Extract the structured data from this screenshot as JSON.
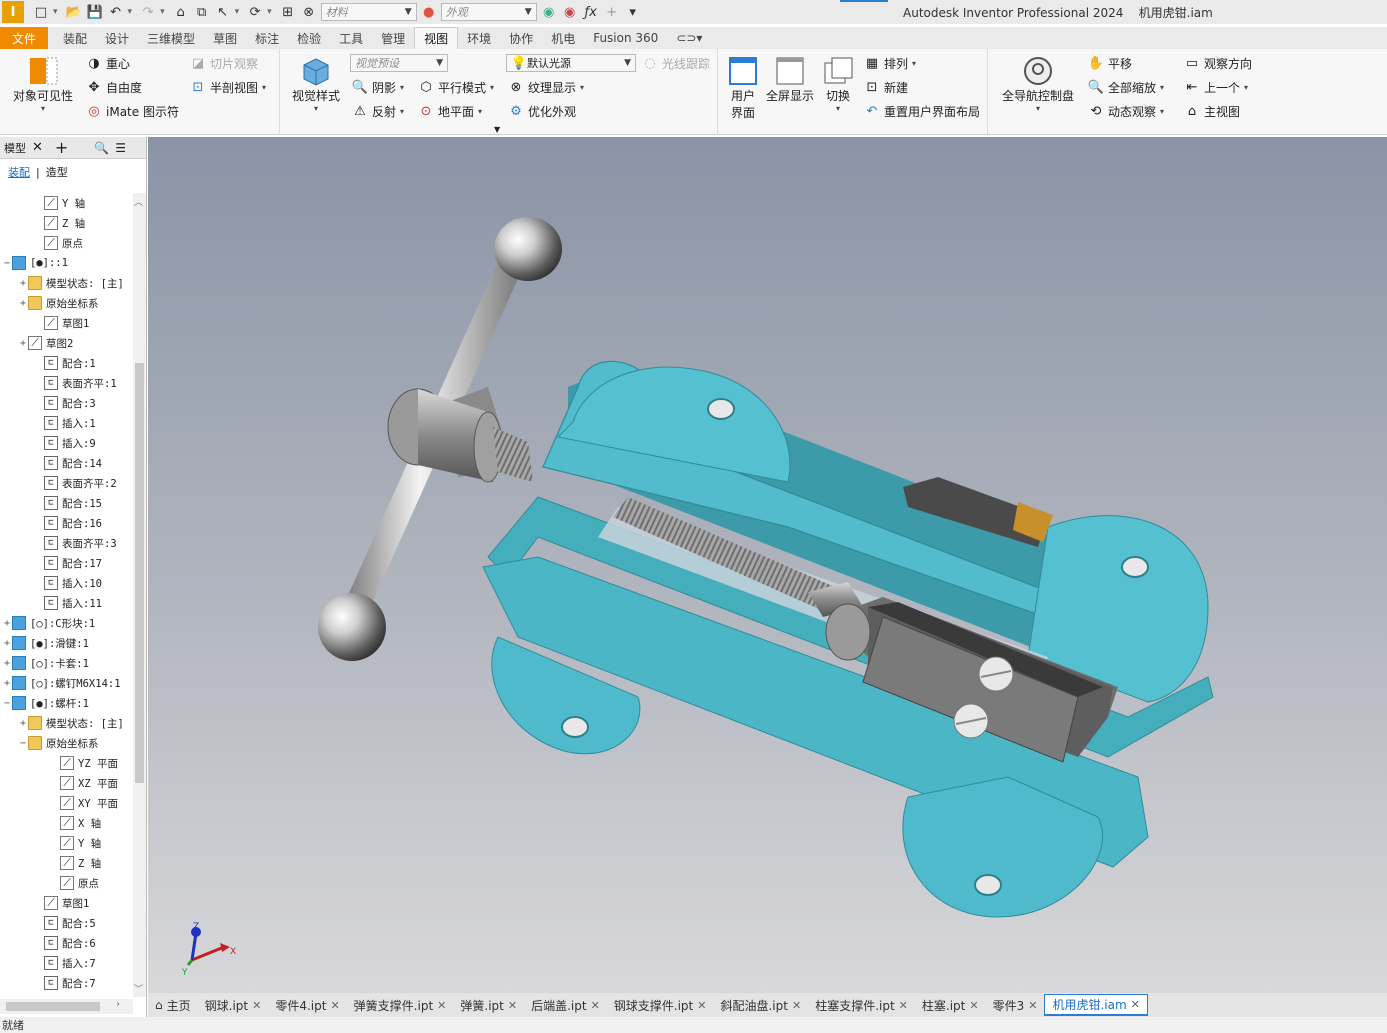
{
  "title": {
    "app": "Autodesk Inventor Professional 2024",
    "file": "机用虎钳.iam",
    "app_letter": "I",
    "material_placeholder": "材料",
    "appearance_placeholder": "外观"
  },
  "tabs": [
    "文件",
    "装配",
    "设计",
    "三维模型",
    "草图",
    "标注",
    "检验",
    "工具",
    "管理",
    "视图",
    "环境",
    "协作",
    "机电",
    "Fusion 360"
  ],
  "active_tab": "视图",
  "ribbon": {
    "visibility": {
      "big": "对象可见性",
      "center_gravity": "重心",
      "dof": "自由度",
      "imate": "iMate 图示符",
      "slice": "切片观察",
      "half_section": "半剖视图"
    },
    "appearance": {
      "visual_style": "视觉样式",
      "visual_preset": "视觉预设",
      "shadows": "阴影",
      "reflections": "反射",
      "ortho": "平行模式",
      "ground_plane": "地平面",
      "lighting": "默认光源",
      "texture": "纹理显示",
      "optimize": "优化外观",
      "raytrace": "光线跟踪"
    },
    "windows": {
      "user_interface": "用户界面",
      "fullscreen": "全屏显示",
      "switch": "切换",
      "arrange": "排列",
      "new": "新建",
      "reset": "重置用户界面布局"
    },
    "navigate": {
      "navbar": "全导航控制盘",
      "pan": "平移",
      "zoom_all": "全部缩放",
      "orbit": "动态观察",
      "look_at": "观察方向",
      "previous": "上一个",
      "home": "主视图"
    }
  },
  "browser": {
    "tab_label": "模型",
    "subtabs": [
      "装配",
      "造型"
    ],
    "active_subtab": "装配",
    "nodes": [
      {
        "indent": 2,
        "icon": "ref",
        "label": "Y 轴"
      },
      {
        "indent": 2,
        "icon": "ref",
        "label": "Z 轴"
      },
      {
        "indent": 2,
        "icon": "ref",
        "label": "原点"
      },
      {
        "indent": 0,
        "expander": "−",
        "icon": "part",
        "label": "[●]::1"
      },
      {
        "indent": 1,
        "expander": "+",
        "icon": "folder",
        "label": "模型状态: [主]"
      },
      {
        "indent": 1,
        "expander": "+",
        "icon": "folder",
        "label": "原始坐标系"
      },
      {
        "indent": 2,
        "icon": "ref",
        "label": "草图1"
      },
      {
        "indent": 1,
        "expander": "+",
        "icon": "ref",
        "label": "草图2"
      },
      {
        "indent": 2,
        "icon": "con",
        "label": "配合:1"
      },
      {
        "indent": 2,
        "icon": "con",
        "label": "表面齐平:1"
      },
      {
        "indent": 2,
        "icon": "con",
        "label": "配合:3"
      },
      {
        "indent": 2,
        "icon": "con",
        "label": "插入:1"
      },
      {
        "indent": 2,
        "icon": "con",
        "label": "插入:9"
      },
      {
        "indent": 2,
        "icon": "con",
        "label": "配合:14"
      },
      {
        "indent": 2,
        "icon": "con",
        "label": "表面齐平:2"
      },
      {
        "indent": 2,
        "icon": "con",
        "label": "配合:15"
      },
      {
        "indent": 2,
        "icon": "con",
        "label": "配合:16"
      },
      {
        "indent": 2,
        "icon": "con",
        "label": "表面齐平:3"
      },
      {
        "indent": 2,
        "icon": "con",
        "label": "配合:17"
      },
      {
        "indent": 2,
        "icon": "con",
        "label": "插入:10"
      },
      {
        "indent": 2,
        "icon": "con",
        "label": "插入:11"
      },
      {
        "indent": 0,
        "expander": "+",
        "icon": "part",
        "label": "[○]:C形块:1"
      },
      {
        "indent": 0,
        "expander": "+",
        "icon": "part",
        "label": "[●]:滑键:1"
      },
      {
        "indent": 0,
        "expander": "+",
        "icon": "part",
        "label": "[○]:卡套:1"
      },
      {
        "indent": 0,
        "expander": "+",
        "icon": "part",
        "label": "[○]:螺钉M6X14:1"
      },
      {
        "indent": 0,
        "expander": "−",
        "icon": "part",
        "label": "[●]:螺杆:1"
      },
      {
        "indent": 1,
        "expander": "+",
        "icon": "folder",
        "label": "模型状态: [主]"
      },
      {
        "indent": 1,
        "expander": "−",
        "icon": "folder",
        "label": "原始坐标系"
      },
      {
        "indent": 3,
        "icon": "ref",
        "label": "YZ 平面"
      },
      {
        "indent": 3,
        "icon": "ref",
        "label": "XZ 平面"
      },
      {
        "indent": 3,
        "icon": "ref",
        "label": "XY 平面"
      },
      {
        "indent": 3,
        "icon": "ref",
        "label": "X 轴"
      },
      {
        "indent": 3,
        "icon": "ref",
        "label": "Y 轴"
      },
      {
        "indent": 3,
        "icon": "ref",
        "label": "Z 轴"
      },
      {
        "indent": 3,
        "icon": "ref",
        "label": "原点"
      },
      {
        "indent": 2,
        "icon": "ref",
        "label": "草图1"
      },
      {
        "indent": 2,
        "icon": "con",
        "label": "配合:5"
      },
      {
        "indent": 2,
        "icon": "con",
        "label": "配合:6"
      },
      {
        "indent": 2,
        "icon": "con",
        "label": "插入:7"
      },
      {
        "indent": 2,
        "icon": "con",
        "label": "配合:7"
      }
    ]
  },
  "viewport": {
    "axis_labels": [
      "X",
      "Y",
      "Z"
    ]
  },
  "doc_tabs": [
    {
      "label": "主页",
      "closable": false
    },
    {
      "label": "钢球.ipt",
      "closable": true
    },
    {
      "label": "零件4.ipt",
      "closable": true
    },
    {
      "label": "弹簧支撑件.ipt",
      "closable": true
    },
    {
      "label": "弹簧.ipt",
      "closable": true
    },
    {
      "label": "后端盖.ipt",
      "closable": true
    },
    {
      "label": "钢球支撑件.ipt",
      "closable": true
    },
    {
      "label": "斜配油盘.ipt",
      "closable": true
    },
    {
      "label": "柱塞支撑件.ipt",
      "closable": true
    },
    {
      "label": "柱塞.ipt",
      "closable": true
    },
    {
      "label": "零件3",
      "closable": true
    },
    {
      "label": "机用虎钳.iam",
      "closable": true,
      "active": true
    }
  ],
  "status": "就绪",
  "colors": {
    "accent": "#f08a00",
    "part_body": "#4fb8c8",
    "steel": "#a8a8a8"
  }
}
